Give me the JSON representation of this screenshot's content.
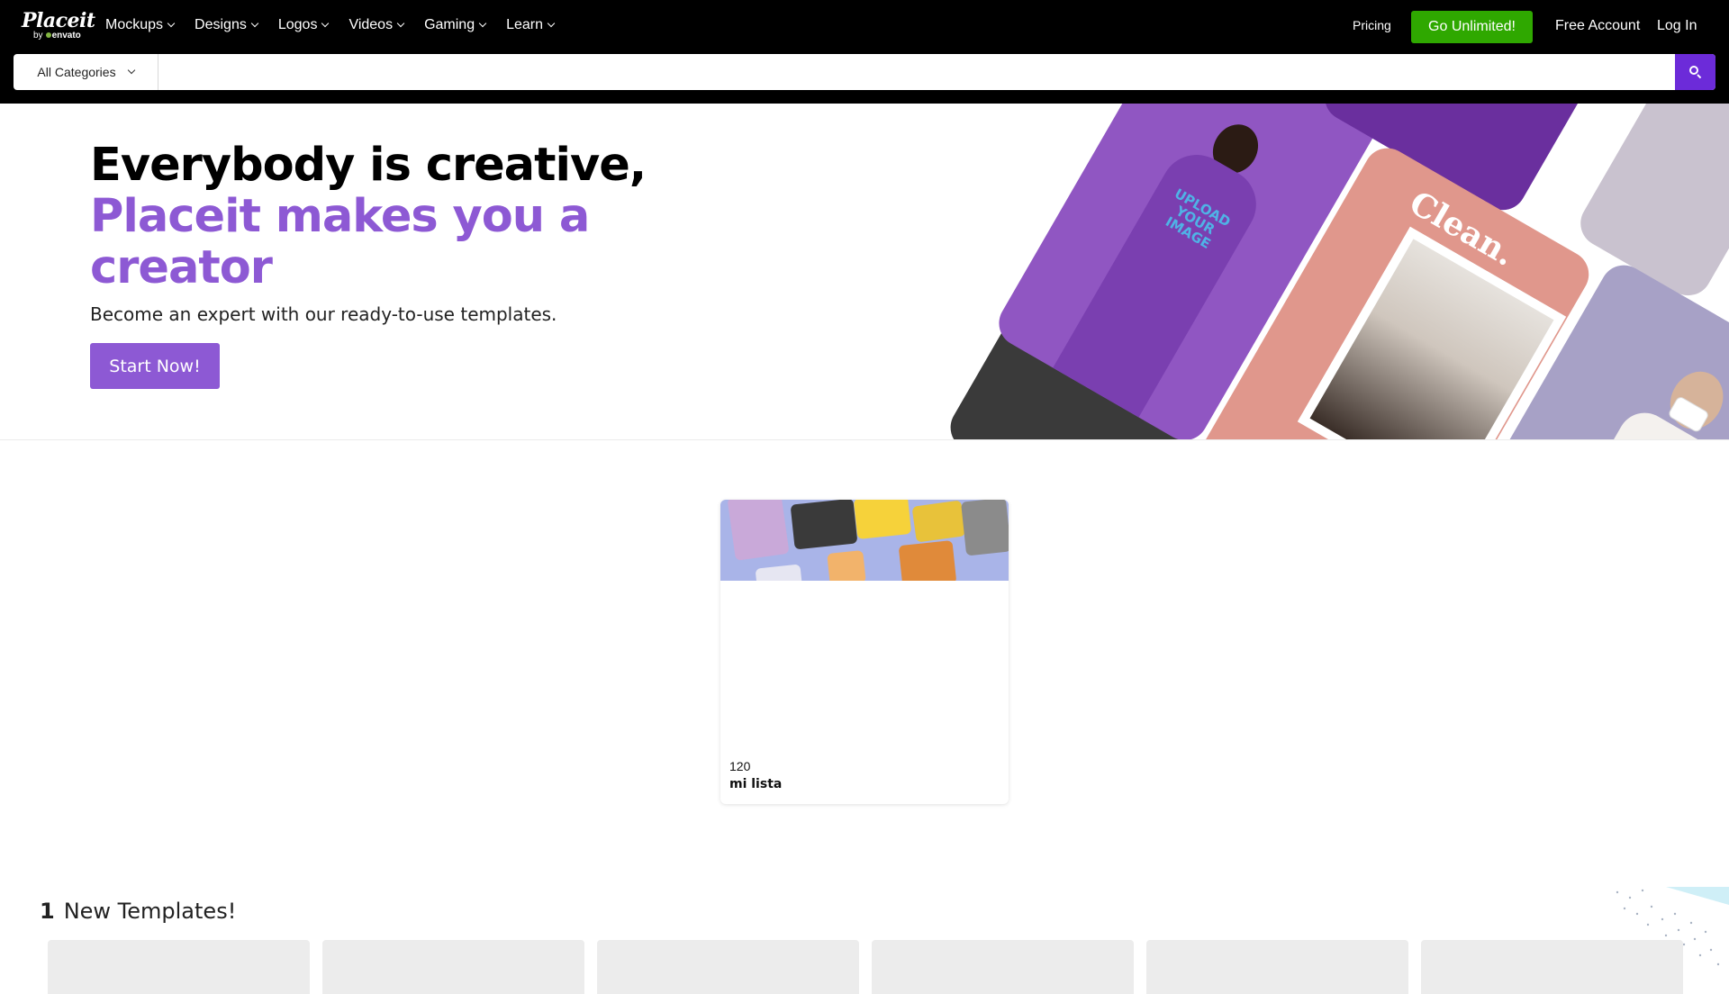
{
  "brand": {
    "name": "Placeit",
    "by_prefix": "by",
    "by_name": "envato",
    "accent_color": "#8d59d4",
    "cta_color": "#2fa800",
    "search_color": "#6c2bd9"
  },
  "nav": {
    "menu": [
      {
        "label": "Mockups"
      },
      {
        "label": "Designs"
      },
      {
        "label": "Logos"
      },
      {
        "label": "Videos"
      },
      {
        "label": "Gaming"
      },
      {
        "label": "Learn"
      }
    ],
    "pricing": "Pricing",
    "unlimited": "Go Unlimited!",
    "free_account": "Free Account",
    "login": "Log In"
  },
  "search": {
    "category": "All Categories",
    "value": "",
    "placeholder": ""
  },
  "hero": {
    "title_line1": "Everybody is creative,",
    "title_line2": "Placeit makes you a creator",
    "subtitle": "Become an expert with our ready-to-use templates.",
    "cta": "Start Now!",
    "collage": {
      "shirt_text": "UPLOAD YOUR IMAGE",
      "clean_text": "Clean."
    }
  },
  "list_card": {
    "count": "120",
    "name": "mi lista"
  },
  "new_templates": {
    "count": "1",
    "label": "New Templates!"
  }
}
